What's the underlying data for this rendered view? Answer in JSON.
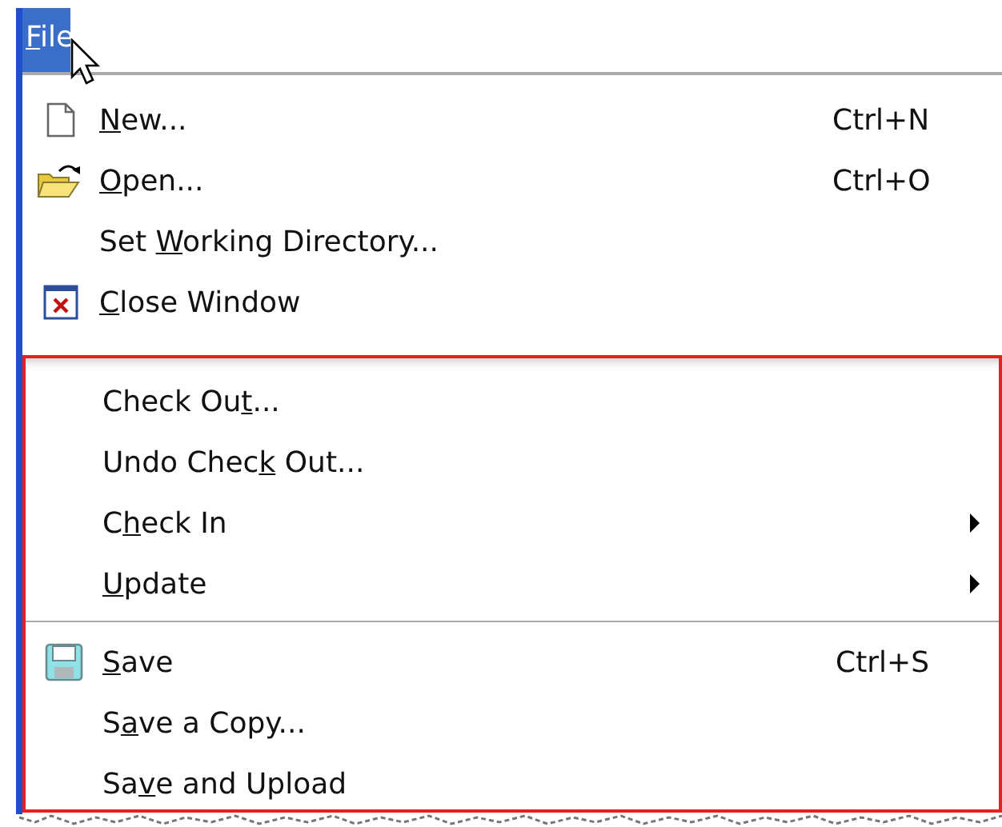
{
  "menu_bar": [
    {
      "label": {
        "key": "F",
        "after": "ile"
      },
      "selected": true
    }
  ],
  "menu": {
    "sections": [
      {
        "highlighted": false,
        "items": [
          {
            "kind": "new",
            "label": {
              "key": "N",
              "after": "ew..."
            },
            "shortcut": "Ctrl+N",
            "submenu": false
          },
          {
            "kind": "open",
            "label": {
              "key": "O",
              "after": "pen..."
            },
            "shortcut": "Ctrl+O",
            "submenu": false
          },
          {
            "kind": "command",
            "label": {
              "before": "Set ",
              "key": "W",
              "after": "orking Directory..."
            },
            "submenu": false
          },
          {
            "kind": "close",
            "label": {
              "key": "C",
              "after": "lose Window"
            },
            "submenu": false
          }
        ]
      },
      {
        "highlighted": true,
        "items": [
          {
            "kind": "command",
            "label": {
              "before": "Check Ou",
              "key": "t",
              "after": "..."
            },
            "submenu": false
          },
          {
            "kind": "command",
            "label": {
              "before": "Undo Chec",
              "key": "k",
              "after": " Out..."
            },
            "submenu": false
          },
          {
            "kind": "command",
            "label": {
              "before": "C",
              "key": "h",
              "after": "eck In"
            },
            "submenu": true
          },
          {
            "kind": "command",
            "label": {
              "key": "U",
              "after": "pdate"
            },
            "submenu": true
          },
          {
            "kind": "separator"
          },
          {
            "kind": "save",
            "label": {
              "key": "S",
              "after": "ave"
            },
            "shortcut": "Ctrl+S",
            "submenu": false
          },
          {
            "kind": "command",
            "label": {
              "before": "S",
              "key": "a",
              "after": "ve a Copy..."
            },
            "submenu": false
          },
          {
            "kind": "command",
            "label": {
              "before": "Sa",
              "key": "v",
              "after": "e and Upload"
            },
            "submenu": false
          }
        ]
      }
    ]
  }
}
